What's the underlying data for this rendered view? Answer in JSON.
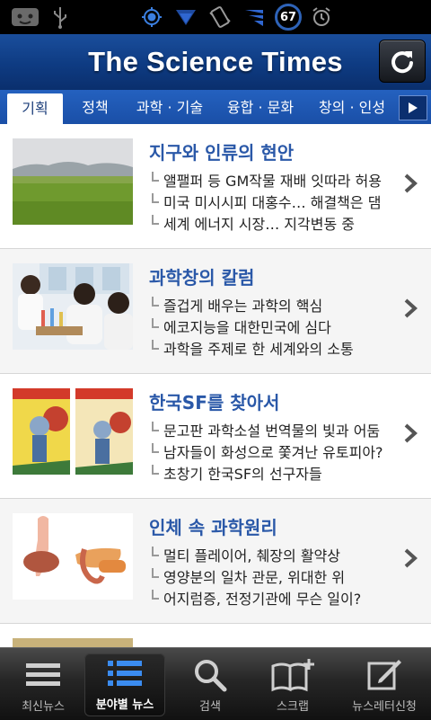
{
  "status_bar": {
    "battery_level": "67",
    "icons": [
      "android-debug-icon",
      "usb-icon",
      "gps-icon",
      "wifi-icon",
      "vibrate-icon",
      "signal-icon",
      "battery-icon",
      "alarm-icon"
    ]
  },
  "header": {
    "title": "The Science Times",
    "refresh_icon": "refresh-icon"
  },
  "tabs": [
    {
      "label": "기획",
      "active": true
    },
    {
      "label": "정책",
      "active": false
    },
    {
      "label": "과학 · 기술",
      "active": false
    },
    {
      "label": "융합 · 문화",
      "active": false
    },
    {
      "label": "창의 · 인성",
      "active": false
    }
  ],
  "articles": [
    {
      "title": "지구와 인류의 현안",
      "bullets": [
        "앨팰퍼 등 GM작물 재배 잇따라 허용",
        "미국 미시시피 대홍수… 해결책은 댐",
        "세계 에너지 시장… 지각변동 중"
      ]
    },
    {
      "title": "과학창의 칼럼",
      "bullets": [
        "즐겁게 배우는 과학의 핵심",
        "에코지능을 대한민국에 심다",
        "과학을 주제로 한 세계와의 소통"
      ]
    },
    {
      "title": "한국SF를 찾아서",
      "bullets": [
        "문고판 과학소설 번역물의 빛과 어둠",
        "남자들이 화성으로 쫓겨난 유토피아?",
        "초창기 한국SF의 선구자들"
      ]
    },
    {
      "title": "인체 속 과학원리",
      "bullets": [
        "멀티 플레이어, 췌장의 활약상",
        "영양분의 일차 관문, 위대한 위",
        "어지럼증, 전정기관에 무슨 일이?"
      ]
    }
  ],
  "bottom_nav": [
    {
      "label": "최신뉴스",
      "icon": "list-icon",
      "active": false
    },
    {
      "label": "분야별 뉴스",
      "icon": "list-icon",
      "active": true
    },
    {
      "label": "검색",
      "icon": "search-icon",
      "active": false
    },
    {
      "label": "스크랩",
      "icon": "book-add-icon",
      "active": false
    },
    {
      "label": "뉴스레터신청",
      "icon": "edit-icon",
      "active": false
    }
  ],
  "colors": {
    "header_blue": "#0e3b82",
    "tab_blue": "#1c54ae",
    "title_blue": "#2a58a8"
  }
}
